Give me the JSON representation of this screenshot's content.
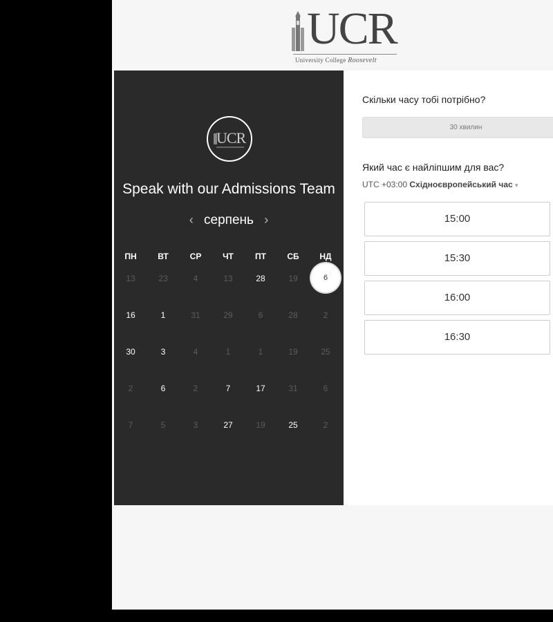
{
  "logo": {
    "text": "UCR",
    "subtitle_prefix": "University College ",
    "subtitle_italic": "Roosevelt"
  },
  "left_panel": {
    "title": "Speak with our Admissions Team",
    "month": "серпень",
    "prev_arrow": "‹",
    "next_arrow": "›",
    "weekdays": [
      "ПН",
      "ВТ",
      "СР",
      "ЧТ",
      "ПТ",
      "СБ",
      "НД"
    ],
    "weeks": [
      [
        {
          "d": "13",
          "on": false
        },
        {
          "d": "23",
          "on": false
        },
        {
          "d": "4",
          "on": false
        },
        {
          "d": "13",
          "on": false
        },
        {
          "d": "28",
          "on": true
        },
        {
          "d": "19",
          "on": false
        },
        {
          "d": "6",
          "on": true,
          "selected": true
        }
      ],
      [
        {
          "d": "16",
          "on": true
        },
        {
          "d": "1",
          "on": true
        },
        {
          "d": "31",
          "on": false
        },
        {
          "d": "29",
          "on": false
        },
        {
          "d": "6",
          "on": false
        },
        {
          "d": "28",
          "on": false
        },
        {
          "d": "2",
          "on": false
        }
      ],
      [
        {
          "d": "30",
          "on": true
        },
        {
          "d": "3",
          "on": true
        },
        {
          "d": "4",
          "on": false
        },
        {
          "d": "1",
          "on": false
        },
        {
          "d": "1",
          "on": false
        },
        {
          "d": "19",
          "on": false
        },
        {
          "d": "25",
          "on": false
        }
      ],
      [
        {
          "d": "2",
          "on": false
        },
        {
          "d": "6",
          "on": true
        },
        {
          "d": "2",
          "on": false
        },
        {
          "d": "7",
          "on": true
        },
        {
          "d": "17",
          "on": true
        },
        {
          "d": "31",
          "on": false
        },
        {
          "d": "6",
          "on": false
        }
      ],
      [
        {
          "d": "7",
          "on": false
        },
        {
          "d": "5",
          "on": false
        },
        {
          "d": "3",
          "on": false
        },
        {
          "d": "27",
          "on": true
        },
        {
          "d": "19",
          "on": false
        },
        {
          "d": "25",
          "on": true
        },
        {
          "d": "2",
          "on": false
        }
      ]
    ]
  },
  "right_panel": {
    "duration_question": "Скільки часу тобі потрібно?",
    "duration_value": "30 хвилин",
    "time_question": "Який час є найліпшим для вас?",
    "timezone_offset": "UTC +03:00 ",
    "timezone_name": "Східноєвропейський час",
    "timezone_caret": "▾",
    "slots": [
      "15:00",
      "15:30",
      "16:00",
      "16:30"
    ]
  }
}
